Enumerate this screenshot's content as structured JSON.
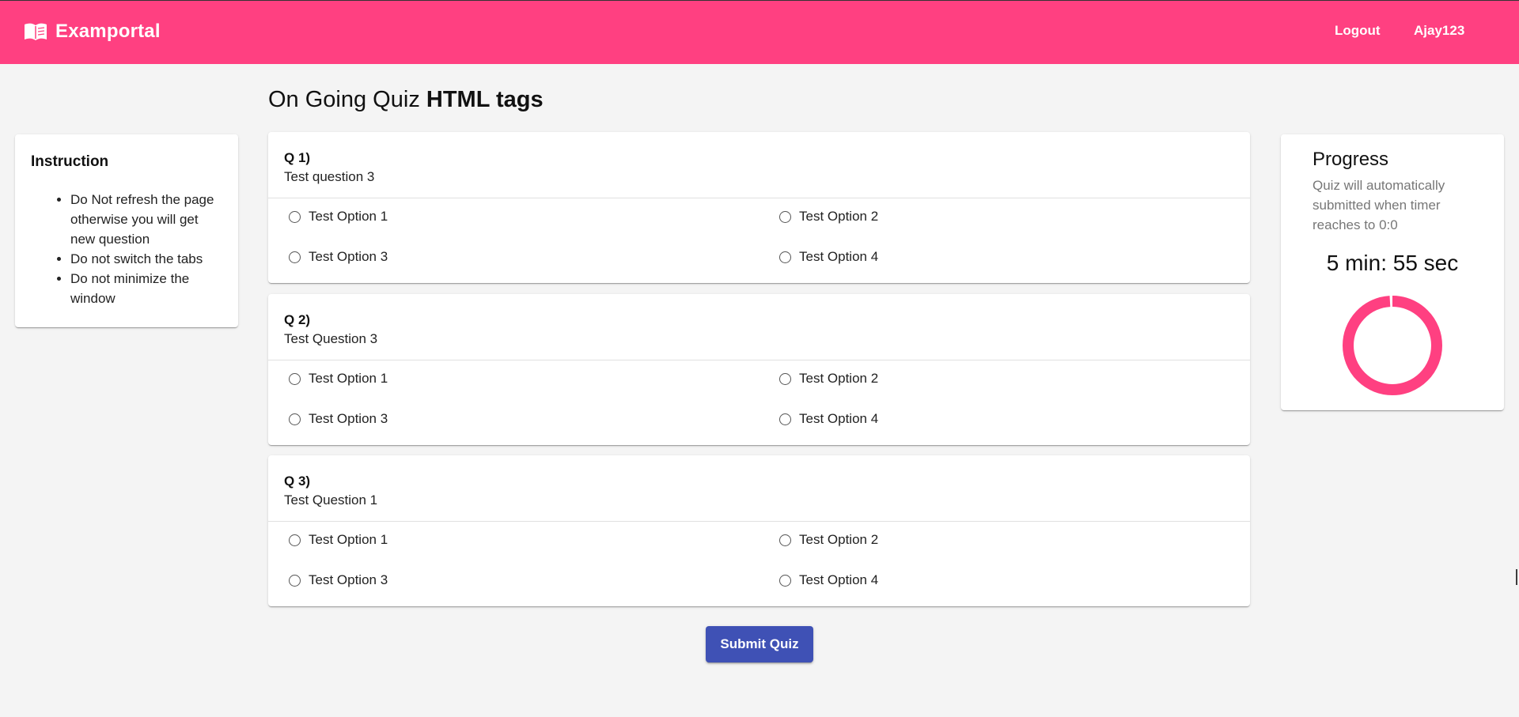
{
  "header": {
    "brand": "Examportal",
    "nav": {
      "logout": "Logout",
      "user": "Ajay123"
    },
    "icon": "menu-book-icon",
    "color": "#ff4081"
  },
  "page": {
    "title_prefix": "On Going Quiz",
    "title_quiz": "HTML tags"
  },
  "instructions": {
    "title": "Instruction",
    "items": [
      "Do Not refresh the page otherwise you will get new question",
      "Do not switch the tabs",
      "Do not minimize the window"
    ]
  },
  "questions": [
    {
      "number": "Q 1)",
      "text": "Test question 3",
      "options": [
        "Test Option 1",
        "Test Option 2",
        "Test Option 3",
        "Test Option 4"
      ]
    },
    {
      "number": "Q 2)",
      "text": "Test Question 3",
      "options": [
        "Test Option 1",
        "Test Option 2",
        "Test Option 3",
        "Test Option 4"
      ]
    },
    {
      "number": "Q 3)",
      "text": "Test Question 1",
      "options": [
        "Test Option 1",
        "Test Option 2",
        "Test Option 3",
        "Test Option 4"
      ]
    }
  ],
  "submit_label": "Submit Quiz",
  "progress": {
    "title": "Progress",
    "subtitle": "Quiz will automatically submitted when timer reaches to 0:0",
    "timer": "5 min: 55 sec",
    "fraction_remaining": 0.99,
    "color": "#ff4081"
  },
  "colors": {
    "primary": "#3f51b5",
    "accent": "#ff4081",
    "background": "#f4f4f4"
  }
}
